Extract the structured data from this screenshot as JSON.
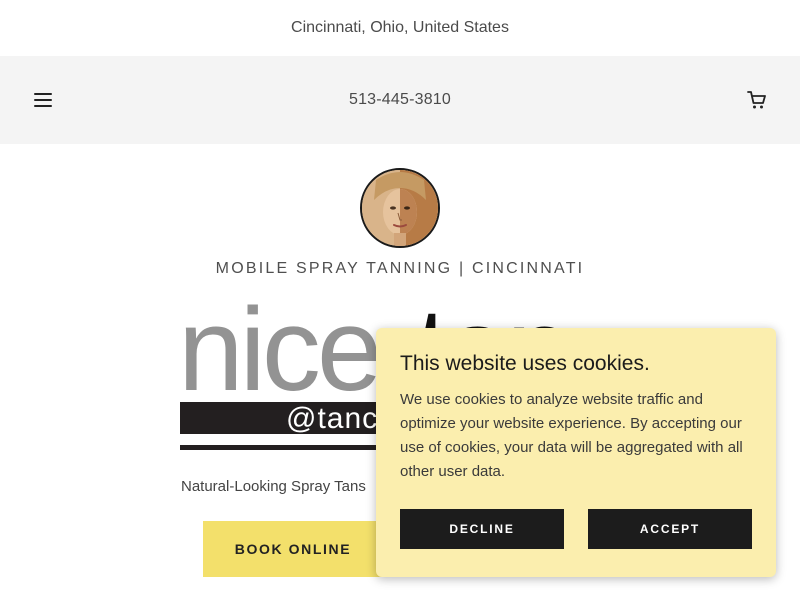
{
  "topbar": {
    "location": "Cincinnati, Ohio, United States"
  },
  "header": {
    "phone": "513-445-3810",
    "menu_icon": "hamburger-menu-icon",
    "cart_icon": "shopping-cart-icon"
  },
  "hero": {
    "tagline": "MOBILE SPRAY TANNING | CINCINNATI",
    "logo_text": {
      "word_nice": "nice",
      "word_tan": "tan",
      "handle": "@tanc"
    },
    "subtitle": "Natural-Looking Spray Tans",
    "book_button": "BOOK ONLINE"
  },
  "cookie_banner": {
    "title": "This website uses cookies.",
    "body": "We use cookies to analyze website traffic and optimize your website experience. By accepting our use of cookies, your data will be aggregated with all other user data.",
    "decline_label": "DECLINE",
    "accept_label": "ACCEPT"
  },
  "colors": {
    "header_bg": "#f4f4f4",
    "book_button": "#f3e06b",
    "cookie_bg": "#fbeeae",
    "cookie_buttons": "#1c1c1c"
  }
}
